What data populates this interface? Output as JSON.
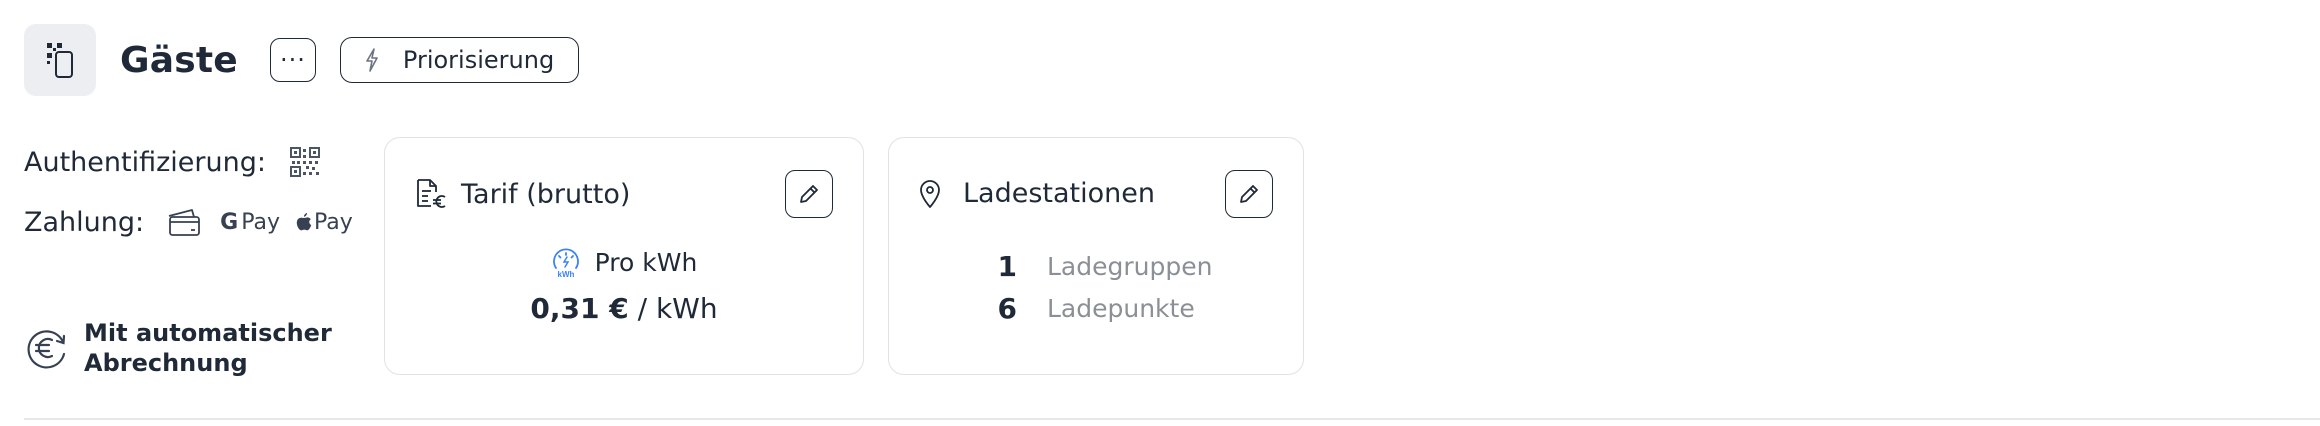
{
  "header": {
    "icon": "qr-phone-icon",
    "title": "Gäste",
    "more_label": "···",
    "priority_label": "Priorisierung",
    "priority_icon": "lightning-icon"
  },
  "info": {
    "auth_label": "Authentifizierung:",
    "auth_icon": "qr-code-icon",
    "payment_label": "Zahlung:",
    "payment_methods": [
      {
        "icon": "credit-card-icon",
        "label": ""
      },
      {
        "icon": "google-g-icon",
        "label": "Pay"
      },
      {
        "icon": "apple-icon",
        "label": "Pay"
      }
    ],
    "billing_icon": "euro-refresh-icon",
    "billing_line1": "Mit automatischer",
    "billing_line2": "Abrechnung"
  },
  "tariff_card": {
    "title": "Tarif (brutto)",
    "title_icon": "document-euro-icon",
    "rate_icon": "kwh-meter-icon",
    "rate_icon_text": "kWh",
    "rate_label": "Pro kWh",
    "price_value": "0,31 €",
    "price_unit": " / kWh"
  },
  "stations_card": {
    "title": "Ladestationen",
    "title_icon": "location-pin-icon",
    "groups_count": "1",
    "groups_label": "Ladegruppen",
    "points_count": "6",
    "points_label": "Ladepunkte"
  },
  "colors": {
    "text": "#1f2937",
    "muted": "#8b8f96",
    "accent_blue": "#3b82f6",
    "card_border": "#dfe2e6",
    "icon_bg": "#eceef1"
  }
}
